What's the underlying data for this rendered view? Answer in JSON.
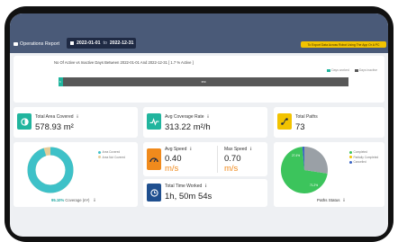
{
  "header": {
    "report_label": "Operations Report",
    "date_from": "2022-01-01",
    "date_sep": "to",
    "date_to": "2022-12-31",
    "export_label": "To Export Data Across Robot Using The App Or A PC"
  },
  "activity": {
    "title": "No Of Active vs Inactive Days Between 2022-01-01 And 2022-12-31 [ 1.7 % Active ]",
    "active_pct": 1.7,
    "active_bar_label": "6",
    "inactive_bar_label": "359",
    "legend_active": "Days worked",
    "legend_inactive": "Days inactive"
  },
  "area": {
    "title": "Total Area Covered",
    "value": "578.93 m²"
  },
  "rate": {
    "title": "Avg Coverage Rate",
    "value": "313.22 m²/h"
  },
  "paths": {
    "title": "Total Paths",
    "value": "73"
  },
  "speed": {
    "avg_title": "Avg Speed",
    "avg_value": "0.40",
    "avg_unit": "m/s",
    "max_title": "Max Speed",
    "max_value": "0.70",
    "max_unit": "m/s"
  },
  "time": {
    "title": "Total Time Worked",
    "value": "1h, 50m 54s"
  },
  "coverage_chart": {
    "legend": [
      "Area Covered",
      "Area Not Covered"
    ],
    "covered_pct": 95.1,
    "caption_pct": "95.10%",
    "caption": "Coverage (m²)"
  },
  "paths_chart": {
    "legend": [
      "Completed",
      "Partially Completed",
      "Cancelled"
    ],
    "slices": [
      71.2,
      1.4,
      27.4
    ],
    "label_completed": "71.2%",
    "label_cancelled": "27.4%",
    "caption": "Paths Status"
  },
  "colors": {
    "header_bg": "#4a5a78",
    "teal": "#21b59e",
    "orange": "#f08a1c",
    "yellow": "#f2c300",
    "navy": "#1f4f8f",
    "gauge_teal": "#3ec1c8",
    "gauge_tan": "#e4cd99",
    "pie_green": "#3cc45c",
    "pie_gray": "#9aa0a6",
    "pie_blue": "#3a63c4"
  },
  "icons": {
    "area": "pie-half-icon",
    "rate": "pulse-icon",
    "paths": "route-icon",
    "speed": "speedometer-icon",
    "time": "clock-icon",
    "info": "info-icon"
  }
}
